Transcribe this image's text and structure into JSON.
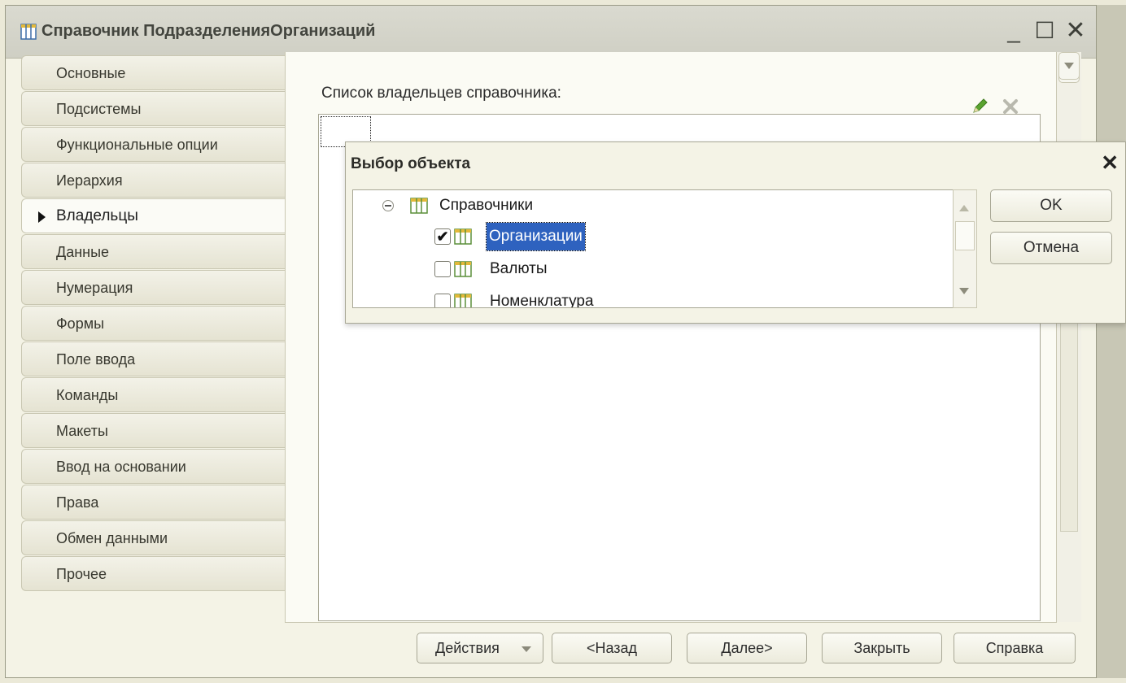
{
  "window": {
    "title": "Справочник ПодразделенияОрганизаций",
    "min_glyph": "_",
    "max_glyph": "☐",
    "close_glyph": "✕"
  },
  "tabs": [
    {
      "label": "Основные",
      "active": false
    },
    {
      "label": "Подсистемы",
      "active": false
    },
    {
      "label": "Функциональные опции",
      "active": false
    },
    {
      "label": "Иерархия",
      "active": false
    },
    {
      "label": "Владельцы",
      "active": true
    },
    {
      "label": "Данные",
      "active": false
    },
    {
      "label": "Нумерация",
      "active": false
    },
    {
      "label": "Формы",
      "active": false
    },
    {
      "label": "Поле ввода",
      "active": false
    },
    {
      "label": "Команды",
      "active": false
    },
    {
      "label": "Макеты",
      "active": false
    },
    {
      "label": "Ввод на основании",
      "active": false
    },
    {
      "label": "Права",
      "active": false
    },
    {
      "label": "Обмен данными",
      "active": false
    },
    {
      "label": "Прочее",
      "active": false
    }
  ],
  "content": {
    "owners_label": "Список владельцев справочника:"
  },
  "buttons": {
    "actions": "Действия",
    "back": "<Назад",
    "next": "Далее>",
    "close": "Закрыть",
    "help": "Справка"
  },
  "dialog": {
    "title": "Выбор объекта",
    "close_glyph": "✕",
    "ok": "OK",
    "cancel": "Отмена",
    "tree": {
      "root": "Справочники",
      "items": [
        {
          "label": "Организации",
          "checked": true,
          "selected": true
        },
        {
          "label": "Валюты",
          "checked": false,
          "selected": false
        },
        {
          "label": "Номенклатура",
          "checked": false,
          "selected": false
        }
      ]
    }
  },
  "colors": {
    "selection": "#2e62bf",
    "grid_icon": "#5b8f3a",
    "pencil": "#5aa32f"
  }
}
